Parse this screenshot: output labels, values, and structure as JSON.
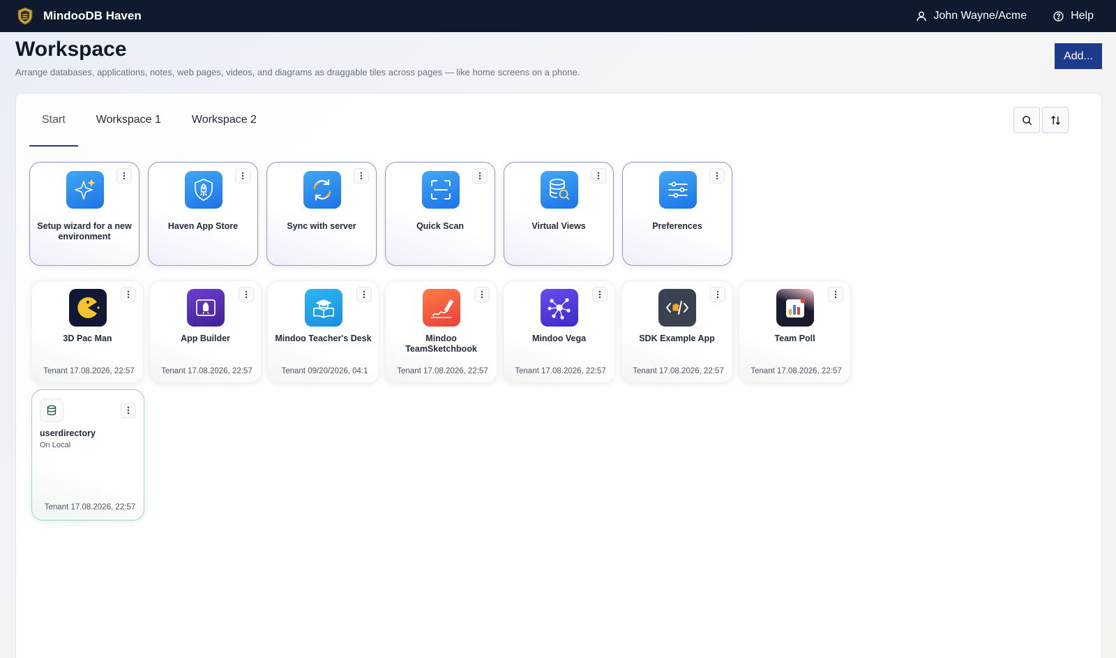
{
  "app": {
    "brand": "MindooDB Haven",
    "user": "John Wayne/Acme",
    "help": "Help"
  },
  "header": {
    "title": "Workspace",
    "subtitle": "Arrange databases, applications, notes, web pages, videos, and diagrams as draggable tiles across pages — like home screens on a phone.",
    "add_label": "Add..."
  },
  "tabs": [
    {
      "label": "Start",
      "active": true
    },
    {
      "label": "Workspace 1",
      "active": false
    },
    {
      "label": "Workspace 2",
      "active": false
    }
  ],
  "tools": {
    "search_icon": "search-icon",
    "sort_icon": "sort-icon"
  },
  "system_tiles": [
    {
      "label": "Setup wizard for a new environment",
      "icon": "sparkle-icon"
    },
    {
      "label": "Haven App Store",
      "icon": "shield-rocket-icon"
    },
    {
      "label": "Sync with server",
      "icon": "sync-icon"
    },
    {
      "label": "Quick Scan",
      "icon": "scan-icon"
    },
    {
      "label": "Virtual Views",
      "icon": "database-search-icon"
    },
    {
      "label": "Preferences",
      "icon": "sliders-icon"
    }
  ],
  "app_tiles": [
    {
      "label": "3D Pac Man",
      "meta": "Tenant 17.08.2026, 22:57",
      "icon": "pacman-icon"
    },
    {
      "label": "App Builder",
      "meta": "Tenant 17.08.2026, 22:57",
      "icon": "app-builder-icon"
    },
    {
      "label": "Mindoo Teacher's Desk",
      "meta": "Tenant 09/20/2026, 04:1",
      "icon": "teacher-book-icon"
    },
    {
      "label": "Mindoo TeamSketchbook",
      "meta": "Tenant 17.08.2026, 22:57",
      "icon": "sketchbook-icon"
    },
    {
      "label": "Mindoo Vega",
      "meta": "Tenant 17.08.2026, 22:57",
      "icon": "network-icon"
    },
    {
      "label": "SDK Example App",
      "meta": "Tenant 17.08.2026, 22:57",
      "icon": "code-puzzle-icon"
    },
    {
      "label": "Team Poll",
      "meta": "Tenant 17.08.2026, 22:57",
      "icon": "poll-chart-icon"
    }
  ],
  "db_tiles": [
    {
      "title": "userdirectory",
      "location": "On Local",
      "meta": "Tenant 17.08.2026, 22:57",
      "icon": "database-icon"
    }
  ],
  "colors": {
    "topbar": "#0f1a2e",
    "accent": "#1e3a8a",
    "system_tile_border": "#8f98c0",
    "db_tile_border": "#9fd6bd"
  }
}
